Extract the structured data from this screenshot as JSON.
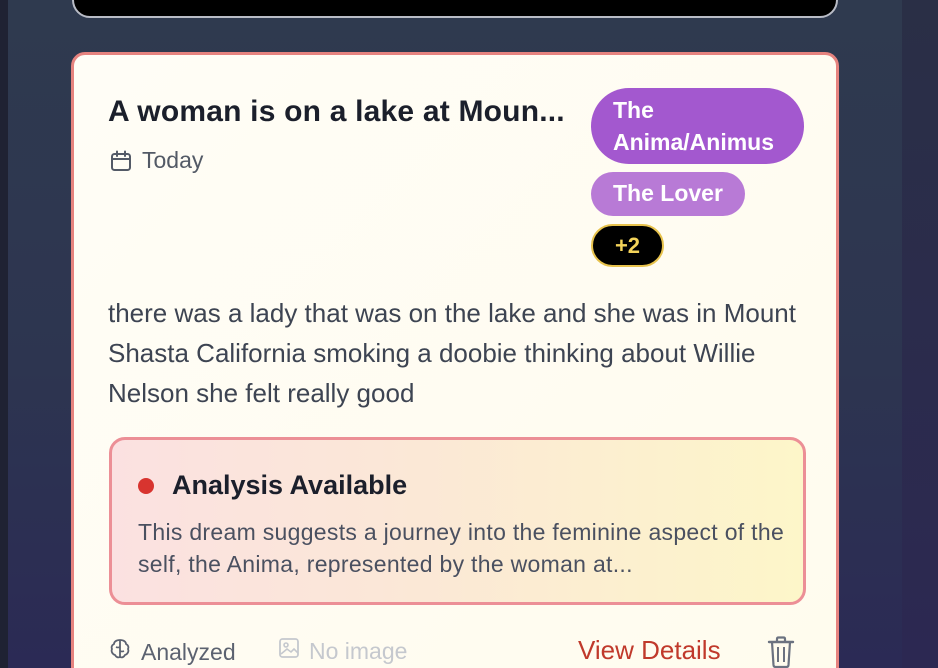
{
  "dream_card": {
    "title": "A woman is on a lake at Moun...",
    "date": "Today",
    "tags": [
      "The Anima/Animus",
      "The Lover"
    ],
    "more_tags": "+2",
    "description": "there was a lady that was on the lake and she was in Mount Shasta California smoking a doobie thinking about Willie Nelson she felt really good",
    "analysis": {
      "title": "Analysis Available",
      "excerpt": "This dream suggests a journey into the feminine aspect of the self, the Anima, represented by the woman at..."
    },
    "footer": {
      "analyzed_label": "Analyzed",
      "image_label": "No image",
      "view_details_label": "View Details"
    }
  },
  "colors": {
    "card_border": "#e6837f",
    "tag_primary": "#a358cf",
    "tag_secondary": "#b87ad6",
    "accent_red": "#c0392b"
  },
  "icons": [
    "calendar-icon",
    "brain-icon",
    "image-icon",
    "trash-icon"
  ]
}
